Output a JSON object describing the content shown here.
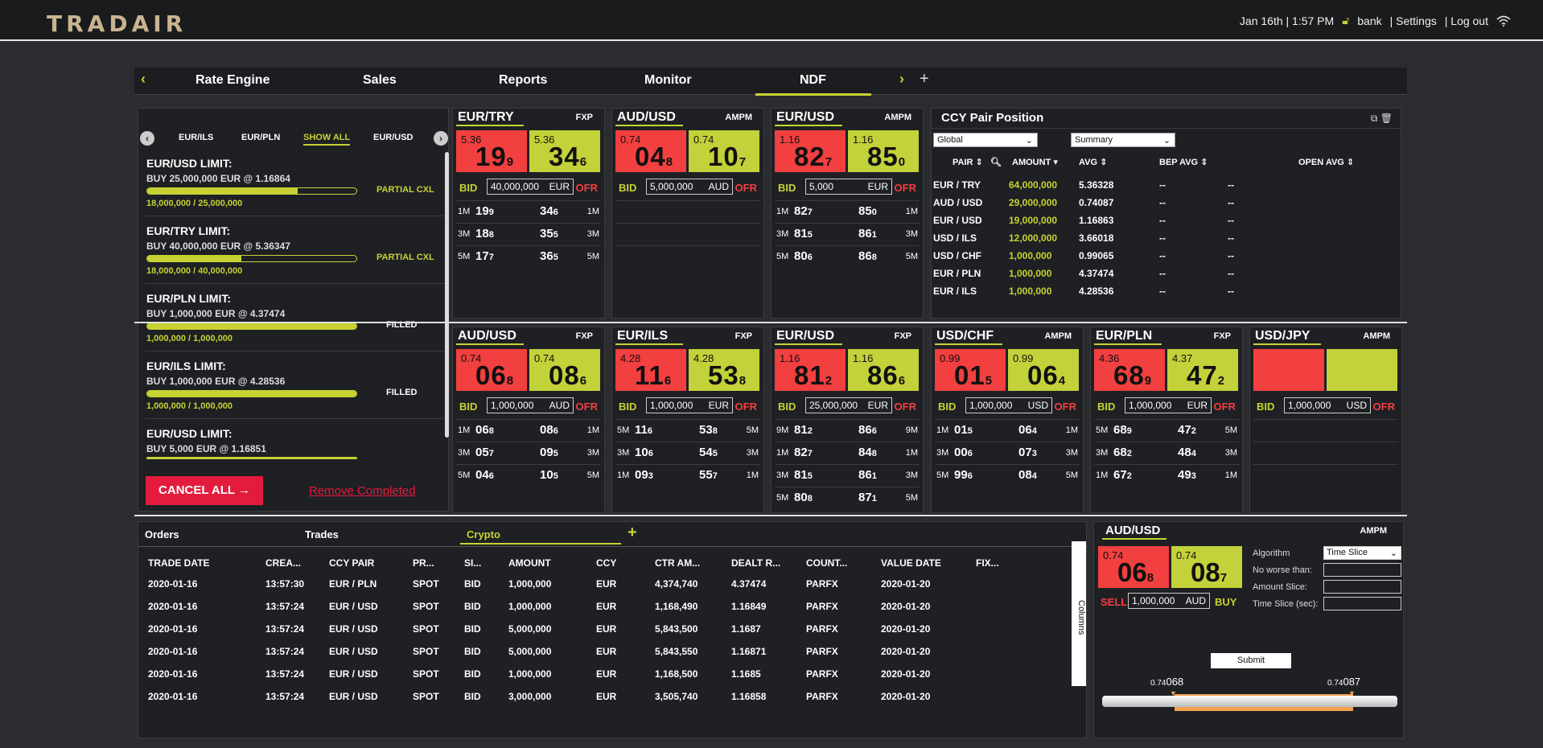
{
  "app": {
    "logo": "TRADAIR"
  },
  "topbar": {
    "datetime": "Jan 16th | 1:57 PM",
    "user": "bank",
    "settings": "| Settings",
    "logout": "| Log out"
  },
  "nav": {
    "tabs": [
      "Rate Engine",
      "Sales",
      "Reports",
      "Monitor",
      "NDF"
    ],
    "active": "NDF",
    "prev": "‹",
    "next": "›",
    "add": "+"
  },
  "limits": {
    "tabs": [
      "EUR/ILS",
      "EUR/PLN",
      "SHOW ALL",
      "EUR/USD"
    ],
    "items": [
      {
        "title": "EUR/USD LIMIT:",
        "desc": "BUY 25,000,000 EUR @ 1.16864",
        "progress": "18,000,000 / 25,000,000",
        "fill": 0.72,
        "status": "PARTIAL CXL"
      },
      {
        "title": "EUR/TRY LIMIT:",
        "desc": "BUY 40,000,000 EUR @ 5.36347",
        "progress": "18,000,000 / 40,000,000",
        "fill": 0.45,
        "status": "PARTIAL CXL"
      },
      {
        "title": "EUR/PLN LIMIT:",
        "desc": "BUY 1,000,000 EUR @ 4.37474",
        "progress": "1,000,000 / 1,000,000",
        "fill": 1.0,
        "status": "FILLED"
      },
      {
        "title": "EUR/ILS LIMIT:",
        "desc": "BUY 1,000,000 EUR @ 4.28536",
        "progress": "1,000,000 / 1,000,000",
        "fill": 1.0,
        "status": "FILLED"
      },
      {
        "title": "EUR/USD LIMIT:",
        "desc": "BUY 5,000 EUR @ 1.16851",
        "progress": "",
        "fill": 0.0,
        "status": ""
      }
    ],
    "cancel_all": "CANCEL ALL →",
    "remove_completed": "Remove Completed"
  },
  "tiles_top": [
    {
      "pair": "EUR/TRY",
      "src": "FXP",
      "bid_small": "5.36",
      "bid_big": "19",
      "bid_pip": "9",
      "ask_small": "5.36",
      "ask_big": "34",
      "ask_pip": "6",
      "qty": "40,000,000",
      "ccy": "EUR",
      "rows": [
        [
          "1M",
          "19",
          "9",
          "34",
          "6",
          "1M"
        ],
        [
          "3M",
          "18",
          "8",
          "35",
          "5",
          "3M"
        ],
        [
          "5M",
          "17",
          "7",
          "36",
          "5",
          "5M"
        ]
      ]
    },
    {
      "pair": "AUD/USD",
      "src": "AMPM",
      "bid_small": "0.74",
      "bid_big": "04",
      "bid_pip": "8",
      "ask_small": "0.74",
      "ask_big": "10",
      "ask_pip": "7",
      "qty": "5,000,000",
      "ccy": "AUD",
      "rows": []
    },
    {
      "pair": "EUR/USD",
      "src": "AMPM",
      "bid_small": "1.16",
      "bid_big": "82",
      "bid_pip": "7",
      "ask_small": "1.16",
      "ask_big": "85",
      "ask_pip": "0",
      "qty": "5,000",
      "ccy": "EUR",
      "rows": [
        [
          "1M",
          "82",
          "7",
          "85",
          "0",
          "1M"
        ],
        [
          "3M",
          "81",
          "5",
          "86",
          "1",
          "3M"
        ],
        [
          "5M",
          "80",
          "6",
          "86",
          "8",
          "5M"
        ]
      ]
    }
  ],
  "tiles_bottom": [
    {
      "pair": "AUD/USD",
      "src": "FXP",
      "bid_small": "0.74",
      "bid_big": "06",
      "bid_pip": "8",
      "ask_small": "0.74",
      "ask_big": "08",
      "ask_pip": "6",
      "qty": "1,000,000",
      "ccy": "AUD",
      "rows": [
        [
          "1M",
          "06",
          "8",
          "08",
          "6",
          "1M"
        ],
        [
          "3M",
          "05",
          "7",
          "09",
          "5",
          "3M"
        ],
        [
          "5M",
          "04",
          "6",
          "10",
          "5",
          "5M"
        ]
      ]
    },
    {
      "pair": "EUR/ILS",
      "src": "FXP",
      "bid_small": "4.28",
      "bid_big": "11",
      "bid_pip": "6",
      "ask_small": "4.28",
      "ask_big": "53",
      "ask_pip": "8",
      "qty": "1,000,000",
      "ccy": "EUR",
      "rows": [
        [
          "5M",
          "11",
          "6",
          "53",
          "8",
          "5M"
        ],
        [
          "3M",
          "10",
          "6",
          "54",
          "5",
          "3M"
        ],
        [
          "1M",
          "09",
          "3",
          "55",
          "7",
          "1M"
        ]
      ]
    },
    {
      "pair": "EUR/USD",
      "src": "FXP",
      "bid_small": "1.16",
      "bid_big": "81",
      "bid_pip": "2",
      "ask_small": "1.16",
      "ask_big": "86",
      "ask_pip": "6",
      "qty": "25,000,000",
      "ccy": "EUR",
      "rows": [
        [
          "9M",
          "81",
          "2",
          "86",
          "6",
          "9M"
        ],
        [
          "1M",
          "82",
          "7",
          "84",
          "8",
          "1M"
        ],
        [
          "3M",
          "81",
          "5",
          "86",
          "1",
          "3M"
        ],
        [
          "5M",
          "80",
          "8",
          "87",
          "1",
          "5M"
        ]
      ]
    },
    {
      "pair": "USD/CHF",
      "src": "AMPM",
      "bid_small": "0.99",
      "bid_big": "01",
      "bid_pip": "5",
      "ask_small": "0.99",
      "ask_big": "06",
      "ask_pip": "4",
      "qty": "1,000,000",
      "ccy": "USD",
      "rows": [
        [
          "1M",
          "01",
          "5",
          "06",
          "4",
          "1M"
        ],
        [
          "3M",
          "00",
          "6",
          "07",
          "3",
          "3M"
        ],
        [
          "5M",
          "99",
          "6",
          "08",
          "4",
          "5M"
        ]
      ]
    },
    {
      "pair": "EUR/PLN",
      "src": "FXP",
      "bid_small": "4.36",
      "bid_big": "68",
      "bid_pip": "9",
      "ask_small": "4.37",
      "ask_big": "47",
      "ask_pip": "2",
      "qty": "1,000,000",
      "ccy": "EUR",
      "rows": [
        [
          "5M",
          "68",
          "9",
          "47",
          "2",
          "5M"
        ],
        [
          "3M",
          "68",
          "2",
          "48",
          "4",
          "3M"
        ],
        [
          "1M",
          "67",
          "2",
          "49",
          "3",
          "1M"
        ]
      ]
    },
    {
      "pair": "USD/JPY",
      "src": "AMPM",
      "bid_small": "",
      "bid_big": "",
      "bid_pip": "",
      "ask_small": "",
      "ask_big": "",
      "ask_pip": "",
      "qty": "1,000,000",
      "ccy": "USD",
      "rows": []
    }
  ],
  "tile_labels": {
    "bid": "BID",
    "ofr": "OFR"
  },
  "position": {
    "title": "CCY Pair Position",
    "scope": "Global",
    "view": "Summary",
    "headers": [
      "PAIR",
      "AMOUNT",
      "AVG",
      "BEP AVG",
      "OPEN AVG"
    ],
    "rows": [
      [
        "EUR / TRY",
        "64,000,000",
        "5.36328",
        "--",
        "--"
      ],
      [
        "AUD / USD",
        "29,000,000",
        "0.74087",
        "--",
        "--"
      ],
      [
        "EUR / USD",
        "19,000,000",
        "1.16863",
        "--",
        "--"
      ],
      [
        "USD / ILS",
        "12,000,000",
        "3.66018",
        "--",
        "--"
      ],
      [
        "USD / CHF",
        "1,000,000",
        "0.99065",
        "--",
        "--"
      ],
      [
        "EUR / PLN",
        "1,000,000",
        "4.37474",
        "--",
        "--"
      ],
      [
        "EUR / ILS",
        "1,000,000",
        "4.28536",
        "--",
        "--"
      ]
    ]
  },
  "orders": {
    "tabs": [
      "Orders",
      "Trades",
      "Crypto"
    ],
    "active": "Crypto",
    "add": "+",
    "columns_label": "Columns",
    "headers": [
      "TRADE DATE",
      "CREA...",
      "CCY PAIR",
      "PR...",
      "SI...",
      "AMOUNT",
      "CCY",
      "CTR AM...",
      "DEALT R...",
      "COUNT...",
      "VALUE DATE",
      "FIX..."
    ],
    "rows": [
      [
        "2020-01-16",
        "13:57:30",
        "EUR / PLN",
        "SPOT",
        "BID",
        "1,000,000",
        "EUR",
        "4,374,740",
        "4.37474",
        "PARFX",
        "2020-01-20"
      ],
      [
        "2020-01-16",
        "13:57:24",
        "EUR / USD",
        "SPOT",
        "BID",
        "1,000,000",
        "EUR",
        "1,168,490",
        "1.16849",
        "PARFX",
        "2020-01-20"
      ],
      [
        "2020-01-16",
        "13:57:24",
        "EUR / USD",
        "SPOT",
        "BID",
        "5,000,000",
        "EUR",
        "5,843,500",
        "1.1687",
        "PARFX",
        "2020-01-20"
      ],
      [
        "2020-01-16",
        "13:57:24",
        "EUR / USD",
        "SPOT",
        "BID",
        "5,000,000",
        "EUR",
        "5,843,550",
        "1.16871",
        "PARFX",
        "2020-01-20"
      ],
      [
        "2020-01-16",
        "13:57:24",
        "EUR / USD",
        "SPOT",
        "BID",
        "1,000,000",
        "EUR",
        "1,168,500",
        "1.1685",
        "PARFX",
        "2020-01-20"
      ],
      [
        "2020-01-16",
        "13:57:24",
        "EUR / USD",
        "SPOT",
        "BID",
        "3,000,000",
        "EUR",
        "3,505,740",
        "1.16858",
        "PARFX",
        "2020-01-20"
      ]
    ]
  },
  "algo": {
    "pair": "AUD/USD",
    "src": "AMPM",
    "sell_small": "0.74",
    "sell_big": "06",
    "sell_pip": "8",
    "buy_small": "0.74",
    "buy_big": "08",
    "buy_pip": "7",
    "sell": "SELL",
    "buy": "BUY",
    "qty": "1,000,000",
    "ccy": "AUD",
    "algorithm_label": "Algorithm",
    "algorithm_value": "Time Slice",
    "no_worse_label": "No worse than:",
    "amount_slice_label": "Amount Slice:",
    "time_slice_label": "Time Slice (sec):",
    "submit": "Submit",
    "range_low_small": "0.74",
    "range_low_big": "068",
    "range_high_small": "0.74",
    "range_high_big": "087"
  },
  "colors": {
    "accent": "#c8d233",
    "bid": "#f23f3f",
    "ask": "#c3d13a",
    "danger": "#e31c3d"
  }
}
